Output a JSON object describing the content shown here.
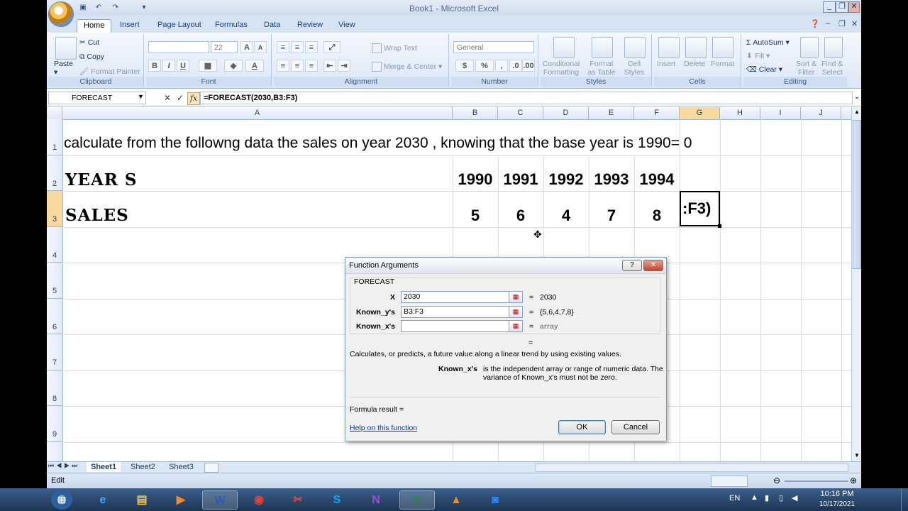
{
  "window": {
    "title": "Book1 - Microsoft Excel",
    "min": "_",
    "max": "❐",
    "close": "✕"
  },
  "tabs": [
    "Home",
    "Insert",
    "Page Layout",
    "Formulas",
    "Data",
    "Review",
    "View"
  ],
  "ribbon": {
    "clipboard": {
      "paste": "Paste",
      "cut": "Cut",
      "copy": "Copy",
      "format_painter": "Format Painter",
      "label": "Clipboard"
    },
    "font": {
      "size": "22",
      "bold": "B",
      "italic": "I",
      "underline": "U",
      "grow": "A",
      "shrink": "A",
      "color": "A",
      "label": "Font"
    },
    "alignment": {
      "wrap_text": "Wrap Text",
      "merge_center": "Merge & Center",
      "label": "Alignment"
    },
    "number": {
      "format": "General",
      "currency": "$",
      "percent": "%",
      "comma": ",",
      "label": "Number"
    },
    "styles": {
      "conditional": [
        "Conditional",
        "Formatting"
      ],
      "format_table": [
        "Format",
        "as Table"
      ],
      "cell_styles": [
        "Cell",
        "Styles"
      ],
      "label": "Styles"
    },
    "cells": {
      "insert": "Insert",
      "delete": "Delete",
      "format": "Format",
      "label": "Cells"
    },
    "editing": {
      "autosum": "AutoSum",
      "fill": "Fill",
      "clear": "Clear",
      "sort_filter": [
        "Sort &",
        "Filter"
      ],
      "find_select": [
        "Find &",
        "Select"
      ],
      "label": "Editing"
    }
  },
  "formula_bar": {
    "name_box": "FORECAST",
    "formula": "=FORECAST(2030,B3:F3)",
    "cancel": "✕",
    "enter": "✓",
    "fx": "fx"
  },
  "columns": [
    "A",
    "B",
    "C",
    "D",
    "E",
    "F",
    "G",
    "H",
    "I",
    "J"
  ],
  "rows": [
    "1",
    "2",
    "3",
    "4",
    "5",
    "6",
    "7",
    "8",
    "9"
  ],
  "cells": {
    "a1": "calculate from the followng data the sales on year 2030 , knowing that the base year is 1990= 0",
    "a2": "YEAR S",
    "a3": "SALES",
    "years": [
      "1990",
      "1991",
      "1992",
      "1993",
      "1994"
    ],
    "sales": [
      "5",
      "6",
      "4",
      "7",
      "8"
    ],
    "g3": ":F3)"
  },
  "dialog": {
    "title": "Function Arguments",
    "function_name": "FORECAST",
    "args": [
      {
        "label": "X",
        "value": "2030",
        "result": "2030"
      },
      {
        "label": "Known_y's",
        "value": "B3:F3",
        "result": "{5,6,4,7,8}"
      },
      {
        "label": "Known_x's",
        "value": "",
        "result": "array"
      }
    ],
    "equals": "=",
    "description": "Calculates, or predicts, a future value along a linear trend by using existing values.",
    "arg_help_label": "Known_x's",
    "arg_help_line1": "is the independent array or range of numeric data. The",
    "arg_help_line2": "variance of Known_x's must not be zero.",
    "formula_result": "Formula result =",
    "help_link": "Help on this function",
    "ok": "OK",
    "cancel": "Cancel",
    "help_btn": "?",
    "close_btn": "✕"
  },
  "sheets": [
    "Sheet1",
    "Sheet2",
    "Sheet3"
  ],
  "status": {
    "mode": "Edit"
  },
  "taskbar": {
    "lang": "EN",
    "time": "10:16 PM",
    "date": "10/17/2021"
  }
}
